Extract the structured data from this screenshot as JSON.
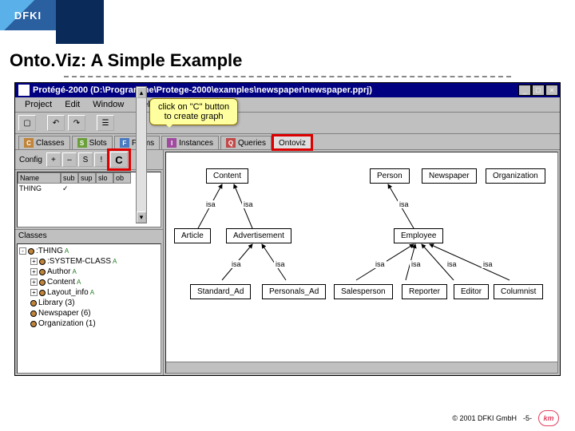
{
  "header": {
    "logo_text": "DFKI"
  },
  "slide": {
    "title": "Onto.Viz: A Simple Example",
    "callout": "click on \"C\" button\nto create graph",
    "footer_copyright": "© 2001 DFKI GmbH",
    "footer_page": "-5-",
    "footer_logo": "km"
  },
  "app": {
    "title_icon": "newspaper",
    "title": "Protégé-2000   (D:\\Programme\\Protege-2000\\examples\\newspaper\\newspaper.pprj)",
    "menus": [
      "Project",
      "Edit",
      "Window",
      "Help"
    ],
    "toolbar_icons": [
      "new",
      "open",
      "save",
      "undo",
      "redo",
      "props"
    ],
    "tabs": [
      {
        "icon": "C",
        "cls": "c",
        "label": "Classes"
      },
      {
        "icon": "S",
        "cls": "s",
        "label": "Slots"
      },
      {
        "icon": "F",
        "cls": "f",
        "label": "Forms"
      },
      {
        "icon": "I",
        "cls": "i",
        "label": "Instances"
      },
      {
        "icon": "Q",
        "cls": "q",
        "label": "Queries"
      },
      {
        "icon": "",
        "cls": "",
        "label": "Ontoviz"
      }
    ],
    "config_label": "Config",
    "config_btns": [
      "+",
      "–",
      "S",
      "!"
    ],
    "c_button": "C",
    "table": {
      "headers": [
        "Name",
        "sub",
        "sup",
        "slo",
        "ob"
      ],
      "row": [
        "THING",
        "✓",
        "",
        "",
        ""
      ]
    },
    "classes_label": "Classes",
    "tree": [
      {
        "toggle": "-",
        "label": ":THING",
        "sup": "A",
        "indent": 0
      },
      {
        "toggle": "+",
        "label": ":SYSTEM-CLASS",
        "sup": "A",
        "indent": 1
      },
      {
        "toggle": "+",
        "label": "Author",
        "sup": "A",
        "indent": 1
      },
      {
        "toggle": "+",
        "label": "Content",
        "sup": "A",
        "indent": 1
      },
      {
        "toggle": "+",
        "label": "Layout_info",
        "sup": "A",
        "indent": 1
      },
      {
        "toggle": "",
        "label": "Library  (3)",
        "sup": "",
        "indent": 1
      },
      {
        "toggle": "",
        "label": "Newspaper  (6)",
        "sup": "",
        "indent": 1
      },
      {
        "toggle": "",
        "label": "Organization  (1)",
        "sup": "",
        "indent": 1
      }
    ],
    "nodes": {
      "content": "Content",
      "person": "Person",
      "newspaper": "Newspaper",
      "organization": "Organization",
      "article": "Article",
      "advertisement": "Advertisement",
      "employee": "Employee",
      "standard_ad": "Standard_Ad",
      "personals_ad": "Personals_Ad",
      "salesperson": "Salesperson",
      "reporter": "Reporter",
      "editor": "Editor",
      "columnist": "Columnist"
    },
    "edge_label": "isa"
  }
}
